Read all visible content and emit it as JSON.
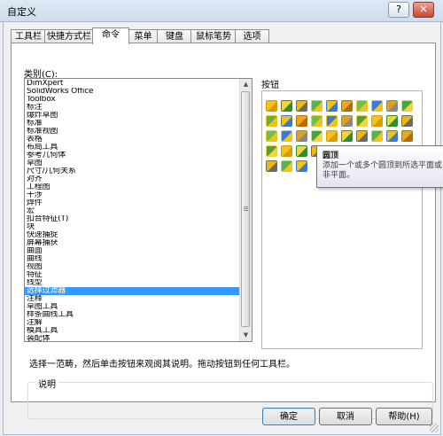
{
  "window": {
    "title": "自定义",
    "help_glyph": "?",
    "close_glyph": "✕"
  },
  "tabs": [
    {
      "label": "工具栏"
    },
    {
      "label": "快捷方式栏"
    },
    {
      "label": "命令"
    },
    {
      "label": "菜单"
    },
    {
      "label": "键盘"
    },
    {
      "label": "鼠标笔势"
    },
    {
      "label": "选项"
    }
  ],
  "active_tab": 2,
  "categories": {
    "label": "类别(C):",
    "selected_index": 26,
    "items": [
      "DimXpert",
      "SolidWorks Office",
      "Toolbox",
      "标注",
      "爆炸草图",
      "标准",
      "标准视图",
      "表格",
      "布局工具",
      "参考几何体",
      "草图",
      "尺寸/几何关系",
      "对齐",
      "工程图",
      "干涉",
      "焊件",
      "宏",
      "扣合特征(T)",
      "块",
      "快速捕捉",
      "屏幕捕获",
      "曲面",
      "曲线",
      "视图",
      "特征",
      "线型",
      "选择过滤器",
      "注释",
      "草图工具",
      "样条曲线工具",
      "注解",
      "模具工具",
      "装配体"
    ]
  },
  "buttons_panel": {
    "label": "按钮"
  },
  "button_icons": [
    [
      "extrude-boss-icon",
      "revolve-icon",
      "sweep-icon",
      "loft-icon",
      "boundary-boss-icon",
      "extrude-cut-icon",
      "hole-icon",
      "revolve-cut-icon",
      "swept-cut-icon",
      "lofted-cut-icon"
    ],
    [
      "boundary-cut-icon",
      "fillet-icon",
      "chamfer-icon",
      "rib-icon",
      "draft-icon",
      "shell-icon",
      "dome-icon",
      "wrap-icon",
      "intersect-icon",
      "mirror-icon"
    ],
    [
      "linear-pattern-icon",
      "circular-pattern-icon",
      "curve-pattern-icon",
      "sketch-pattern-icon",
      "table-pattern-icon",
      "fill-pattern-icon",
      "move-face-icon",
      "delete-face-icon",
      "split-icon",
      "scale-icon"
    ],
    [
      "flex-icon",
      "deform-icon",
      "indent-icon",
      "freeform-icon",
      "combine-icon",
      "thicken-icon",
      "cavity-icon",
      "instant3d-icon",
      "join-icon",
      "imported-icon"
    ],
    [
      "pattern-driven-icon",
      "variable-pattern-icon",
      "library-feature-icon"
    ]
  ],
  "tooltip": {
    "title": "圆顶",
    "description": "添加一个或多个圆顶到所选平面或非平面。"
  },
  "instruction": "选择一范畴，然后单击按钮来观阅其说明。拖动按钮到任何工具栏。",
  "description_group": {
    "label": "说明"
  },
  "footer": {
    "ok": "确定",
    "cancel": "取消",
    "help": "帮助(H)"
  }
}
